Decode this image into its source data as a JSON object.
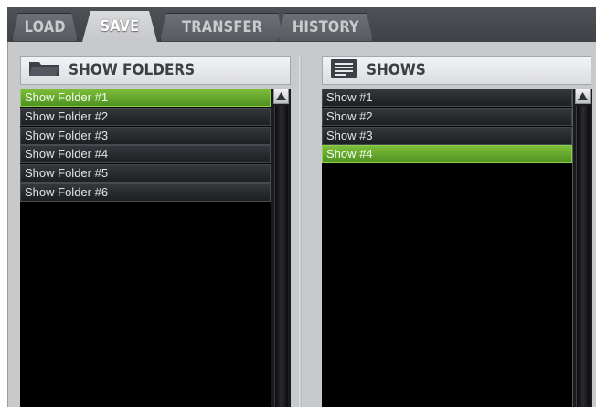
{
  "tabs": [
    {
      "label": "LOAD"
    },
    {
      "label": "SAVE"
    },
    {
      "label": "TRANSFER"
    },
    {
      "label": "HISTORY"
    }
  ],
  "active_tab": "SAVE",
  "folders": {
    "title": "SHOW FOLDERS",
    "icon": "folder-icon",
    "items": [
      {
        "label": "Show Folder #1"
      },
      {
        "label": "Show Folder #2"
      },
      {
        "label": "Show Folder #3"
      },
      {
        "label": "Show Folder #4"
      },
      {
        "label": "Show Folder #5"
      },
      {
        "label": "Show Folder #6"
      }
    ],
    "selected_index": 0
  },
  "shows": {
    "title": "SHOWS",
    "icon": "document-icon",
    "items": [
      {
        "label": "Show #1"
      },
      {
        "label": "Show #2"
      },
      {
        "label": "Show #3"
      },
      {
        "label": "Show #4"
      }
    ],
    "selected_index": 3
  },
  "colors": {
    "selection_green": "#5fa52a",
    "list_background": "#000000",
    "panel_gray": "#c8c9cb"
  }
}
